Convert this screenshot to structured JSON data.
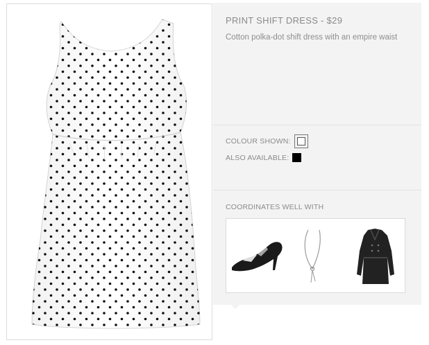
{
  "product": {
    "title": "PRINT SHIFT DRESS - $29",
    "description": "Cotton polka-dot shift dress with an empire waist",
    "image_name": "polka-dot-dress-image"
  },
  "colours": {
    "shown_label": "COLOUR SHOWN:",
    "shown_colour": "#ffffff",
    "available_label": "ALSO AVAILABLE:",
    "available_colour": "#000000"
  },
  "coordinates": {
    "title": "COORDINATES WELL WITH",
    "items": [
      {
        "name": "black-strappy-heels"
      },
      {
        "name": "pendant-necklace"
      },
      {
        "name": "black-trench-coat"
      }
    ]
  }
}
